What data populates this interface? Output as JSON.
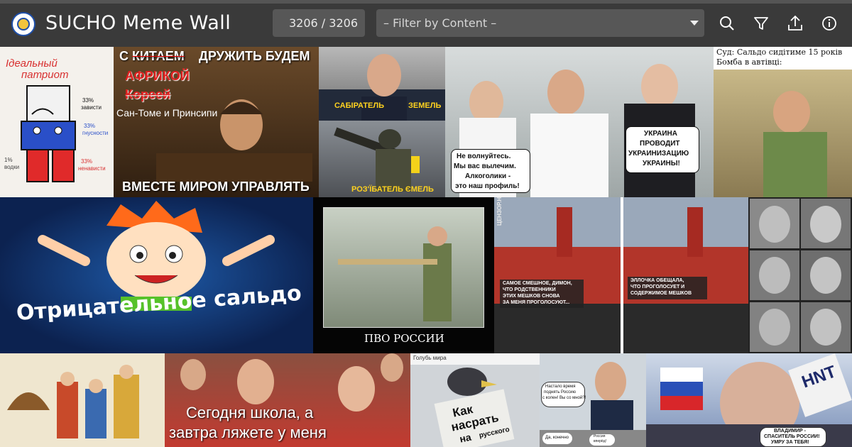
{
  "app": {
    "title": "SUCHO Meme Wall",
    "counter": "3206 / 3206",
    "filter_placeholder": "– Filter by Content –"
  },
  "toolbar_icons": [
    "search-icon",
    "filter-icon",
    "upload-icon",
    "info-icon"
  ],
  "colors": {
    "topbar": "#3a3a3a",
    "control_bg": "#575757",
    "text": "#ffffff"
  },
  "memes": {
    "m1": {
      "t1": "Ідеальный",
      "t2": "патриот",
      "p1": "33%",
      "l1": "зависти",
      "p2": "33%",
      "l2": "гнусности",
      "p3": "1%",
      "l3": "водки",
      "p4": "33%",
      "l4": "ненависти"
    },
    "m2": {
      "t1": "С",
      "t2": "КИТАЕМ",
      "t3": "ДРУЖИТЬ БУДЕМ",
      "t4": "АФРИКОЙ",
      "t5": "Кореей",
      "t6": "Сан-Томе и Принсипи",
      "t7": "ВМЕСТЕ МИРОМ УПРАВЛЯТЬ"
    },
    "m3": {
      "t1": "САБІРАТЕЛЬ",
      "t2": "ЗЕМЕЛЬ"
    },
    "m4": {
      "t1": "РОЗ'ЇБАТЕЛЬ ЄМЕЛЬ"
    },
    "m5": {
      "t1": "Не волнуйтесь.",
      "t2": "Мы вас вылечим.",
      "t3": "Алкоголики -",
      "t4": "это наш профиль!",
      "t5": "УКРАИНА",
      "t6": "ПРОВОДИТ",
      "t7": "УКРАИНИЗАЦИЮ",
      "t8": "УКРАИНЫ!"
    },
    "m6": {
      "t1": "Суд: Сальдо сидітиме 15 років",
      "t2": "Бомба в автівці:"
    },
    "m7": {
      "t1": "Отрицательное сальдо"
    },
    "m8": {
      "t1": "ПВО РОССИИ"
    },
    "m9": {
      "t1": "САМОЕ СМЕШНОЕ, ДИМОН,",
      "t2": "ЧТО РОДСТВЕННИКИ",
      "t3": "ЭТИХ МЕШКОВ СНОВА",
      "t4": "ЗА МЕНЯ ПРОГОЛОСУЮТ...",
      "t5": "ЭЛЛОЧКА ОБЕЩАЛА,",
      "t6": "ЧТО ПРОГОЛОСУЕТ И",
      "t7": "СОДЕРЖИМОЕ МЕШКОВ",
      "t8": "ЦЕНЗОР.НЕТ"
    },
    "m10": {
      "t1": "Сегодня школа, а",
      "t2": "завтра ляжете у меня"
    },
    "m11": {
      "t1": "Голубь мира",
      "t2": "Как",
      "t3": "насрать",
      "t4": "на",
      "t5": "русского"
    },
    "m12": {
      "t1": "Настало время",
      "t2": "поднять Россию",
      "t3": "с колен! Вы со мной?!",
      "t4": "Да, конечно",
      "t5": "Россия",
      "t6": "вперёд!"
    },
    "m13": {
      "t1": "ВЛАДИМИР -",
      "t2": "СПАСИТЕЛЬ РОССИИ!",
      "t3": "УМРУ ЗА ТЕБЯ!",
      "t4": "HNT"
    }
  }
}
